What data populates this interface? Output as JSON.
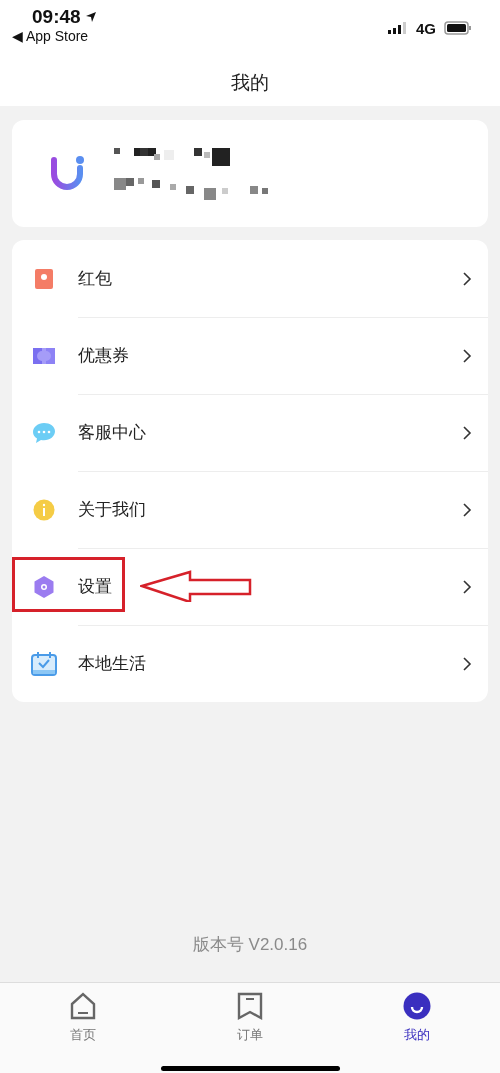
{
  "status_bar": {
    "time": "09:48",
    "back_label": "◀ App Store",
    "network": "4G"
  },
  "header": {
    "title": "我的"
  },
  "profile": {
    "kind": "redacted"
  },
  "menu": [
    {
      "kind": "red-packet",
      "label": "红包",
      "annotated": false
    },
    {
      "kind": "coupon",
      "label": "优惠券",
      "annotated": false
    },
    {
      "kind": "chat",
      "label": "客服中心",
      "annotated": false
    },
    {
      "kind": "info",
      "label": "关于我们",
      "annotated": false
    },
    {
      "kind": "settings",
      "label": "设置",
      "annotated": true
    },
    {
      "kind": "calendar",
      "label": "本地生活",
      "annotated": false
    }
  ],
  "version": "版本号 V2.0.16",
  "tab_bar": [
    {
      "kind": "home",
      "label": "首页",
      "selected": false
    },
    {
      "kind": "orders",
      "label": "订单",
      "selected": false
    },
    {
      "kind": "me",
      "label": "我的",
      "selected": true
    }
  ]
}
